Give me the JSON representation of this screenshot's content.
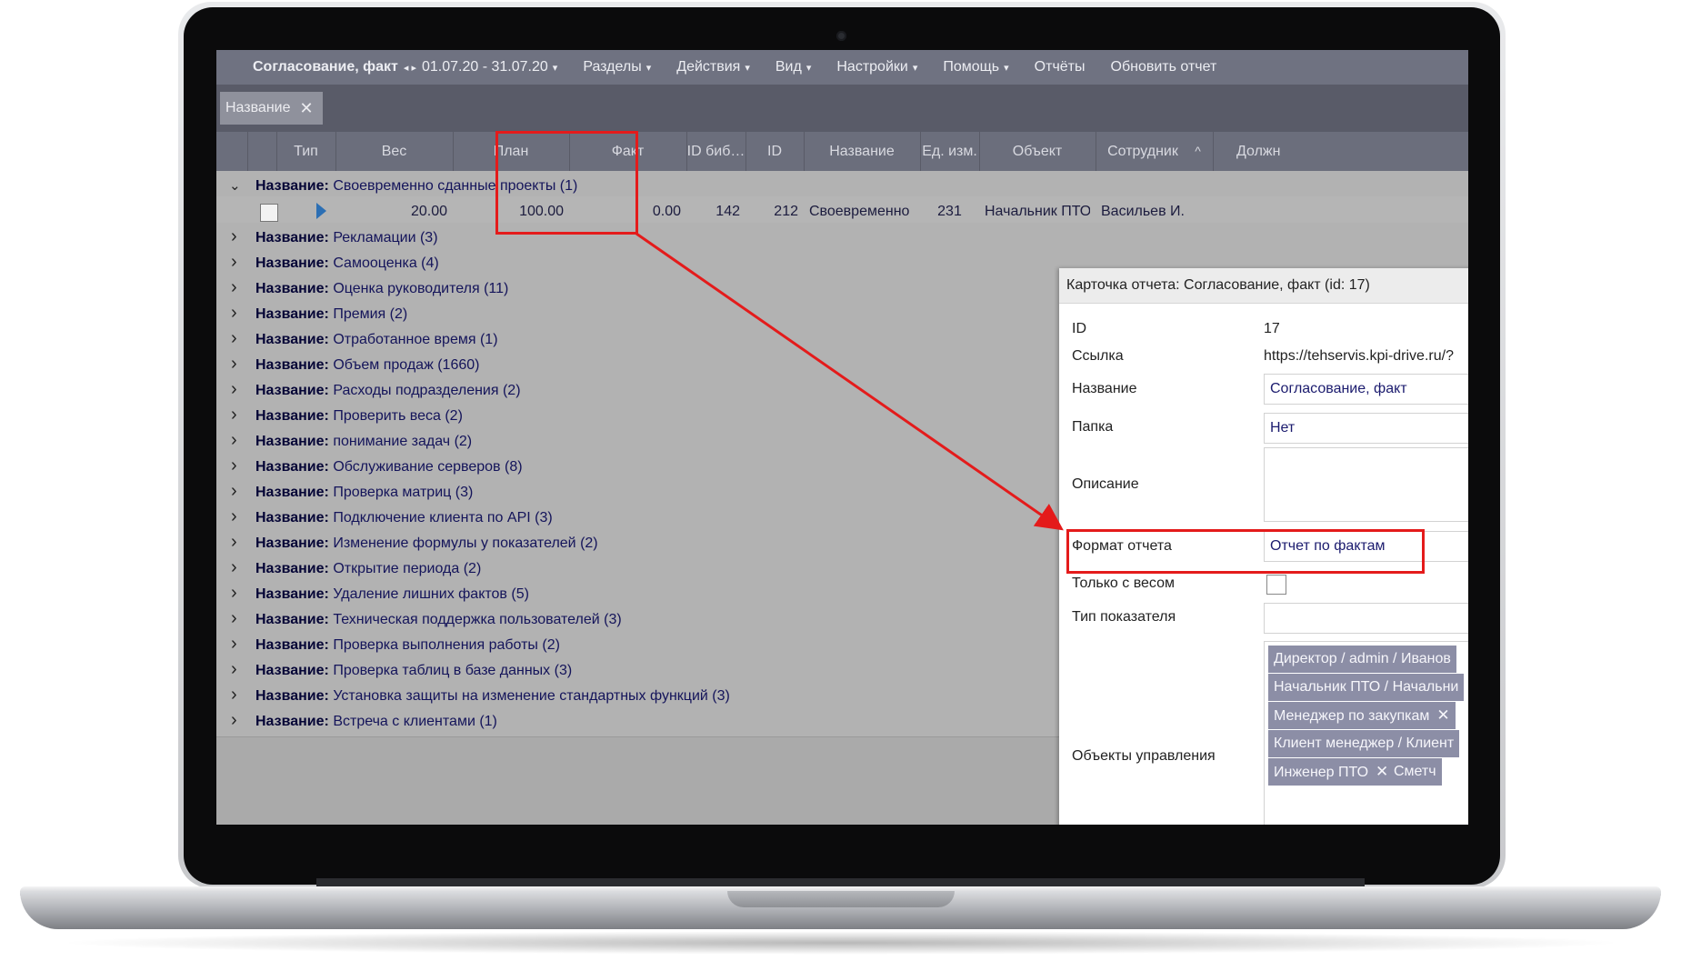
{
  "menubar": {
    "title": "Согласование, факт",
    "period_arrows": "◂ ▸",
    "period": "01.07.20 - 31.07.20",
    "items": [
      "Разделы",
      "Действия",
      "Вид",
      "Настройки",
      "Помощь",
      "Отчёты",
      "Обновить отчет"
    ],
    "caret": "▾"
  },
  "filter": {
    "chip_label": "Название",
    "chip_close": "✕"
  },
  "columns": [
    "",
    "Тип",
    "Вес",
    "План",
    "Факт",
    "ID биб…",
    "ID",
    "Название",
    "Ед. изм.",
    "Объект",
    "Сотрудник",
    "Должн"
  ],
  "sort_indicator": "^",
  "groups": [
    {
      "key": "Название:",
      "value": "Своевременно сданные проекты (1)",
      "expanded": true
    },
    {
      "key": "Название:",
      "value": "Рекламации (3)"
    },
    {
      "key": "Название:",
      "value": "Самооценка (4)"
    },
    {
      "key": "Название:",
      "value": "Оценка руководителя (11)"
    },
    {
      "key": "Название:",
      "value": "Премия (2)"
    },
    {
      "key": "Название:",
      "value": "Отработанное время (1)"
    },
    {
      "key": "Название:",
      "value": "Объем продаж (1660)"
    },
    {
      "key": "Название:",
      "value": "Расходы подразделения (2)"
    },
    {
      "key": "Название:",
      "value": "Проверить веса (2)"
    },
    {
      "key": "Название:",
      "value": "понимание задач (2)"
    },
    {
      "key": "Название:",
      "value": "Обслуживание серверов (8)"
    },
    {
      "key": "Название:",
      "value": "Проверка матриц (3)"
    },
    {
      "key": "Название:",
      "value": "Подключение клиента по API (3)"
    },
    {
      "key": "Название:",
      "value": "Изменение формулы у показателей (2)"
    },
    {
      "key": "Название:",
      "value": "Открытие периода (2)"
    },
    {
      "key": "Название:",
      "value": "Удаление лишних фактов (5)"
    },
    {
      "key": "Название:",
      "value": "Техническая поддержка пользователей (3)"
    },
    {
      "key": "Название:",
      "value": "Проверка выполнения работы (2)"
    },
    {
      "key": "Название:",
      "value": "Проверка таблиц в базе данных (3)"
    },
    {
      "key": "Название:",
      "value": "Установка защиты на изменение стандартных функций (3)"
    },
    {
      "key": "Название:",
      "value": "Встреча с клиентами (1)"
    }
  ],
  "data_row": {
    "weight": "20.00",
    "plan": "100.00",
    "fact": "0.00",
    "lib_id": "142",
    "id": "212",
    "name": "Своевременно …",
    "unit": "231",
    "object": "Начальник ПТО",
    "employee": "Васильев И."
  },
  "card": {
    "title": "Карточка отчета: Согласование, факт (id: 17)",
    "id_label": "ID",
    "id_value": "17",
    "link_label": "Ссылка",
    "link_value": "https://tehservis.kpi-drive.ru/?",
    "name_label": "Название",
    "name_value": "Согласование, факт",
    "folder_label": "Папка",
    "folder_value": "Нет",
    "desc_label": "Описание",
    "desc_value": "",
    "format_label": "Формат отчета",
    "format_value": "Отчет по фактам",
    "weight_only_label": "Только с весом",
    "weight_only_checked": false,
    "indicator_type_label": "Тип показателя",
    "indicator_type_value": "",
    "objects_label": "Объекты управления",
    "tags": [
      {
        "text": "Директор / admin / Иванов",
        "closable": false
      },
      {
        "text": "Начальник ПТО / Начальни",
        "closable": false
      },
      {
        "text": "Менеджер по закупкам",
        "closable": true
      },
      {
        "text": "Клиент менеджер / Клиент",
        "closable": false
      },
      {
        "text": "Инженер ПТО",
        "closable": true
      },
      {
        "text": "Сметч",
        "closable": false
      }
    ],
    "tag_close": "✕"
  },
  "colors": {
    "highlight": "#e41b1b",
    "menubar": "#6f7281",
    "grid": "#b2b2b2",
    "tag": "#8c8ea6"
  }
}
